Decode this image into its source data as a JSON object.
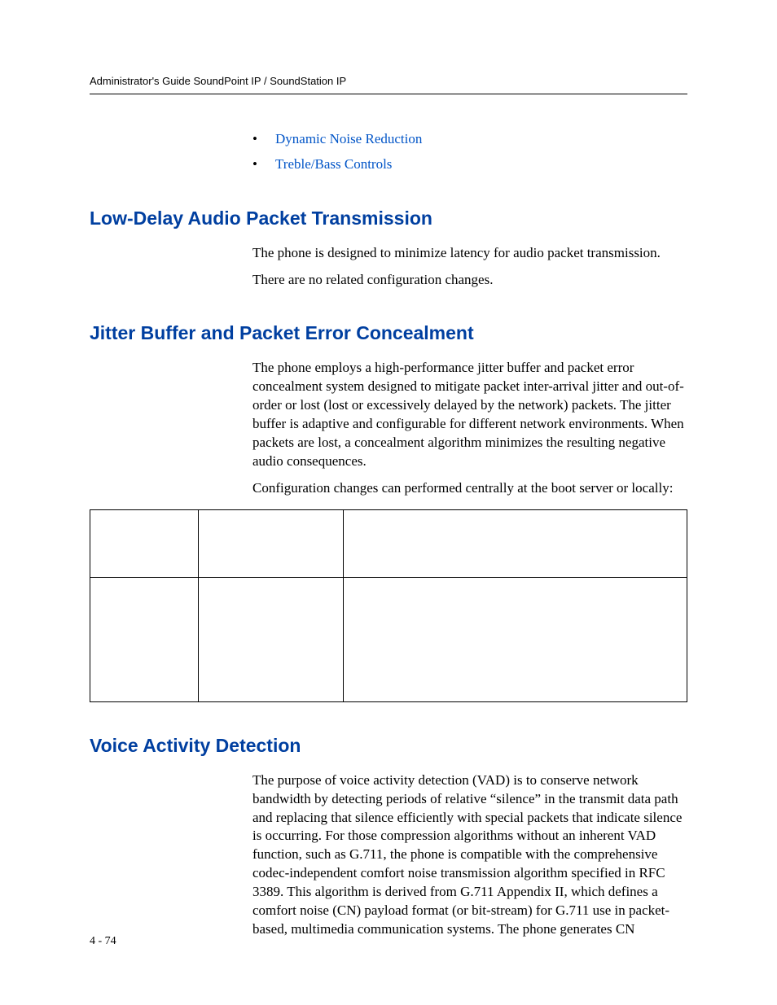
{
  "header": {
    "running": "Administrator's Guide SoundPoint IP / SoundStation IP"
  },
  "bullets": {
    "item1": "Dynamic Noise Reduction",
    "item2": "Treble/Bass Controls"
  },
  "section1": {
    "heading": "Low-Delay Audio Packet Transmission",
    "p1": "The phone is designed to minimize latency for audio packet transmission.",
    "p2": "There are no related configuration changes."
  },
  "section2": {
    "heading": "Jitter Buffer and Packet Error Concealment",
    "p1": "The phone employs a high-performance jitter buffer and packet error concealment system designed to mitigate packet inter-arrival jitter and out-of-order or lost (lost or excessively delayed by the network) packets. The jitter buffer is adaptive and configurable for different network environments. When packets are lost, a concealment algorithm minimizes the resulting negative audio consequences.",
    "p2": "Configuration changes can performed centrally at the boot server or locally:"
  },
  "section3": {
    "heading": "Voice Activity Detection",
    "p1": "The purpose of voice activity detection (VAD) is to conserve network bandwidth by detecting periods of relative “silence” in the transmit data path and replacing that silence efficiently with special packets that indicate silence is occurring. For those compression algorithms without an inherent VAD function, such as G.711, the phone is compatible with the comprehensive codec-independent comfort noise transmission algorithm specified in RFC 3389. This algorithm is derived from G.711 Appendix II, which defines a comfort noise (CN) payload format (or bit-stream) for G.711 use in packet-based, multimedia communication systems. The phone generates CN"
  },
  "table": {
    "rows": [
      {
        "c1": "",
        "c2": "",
        "c3": ""
      },
      {
        "c1": "",
        "c2": "",
        "c3": ""
      }
    ]
  },
  "pageNumber": "4 - 74"
}
